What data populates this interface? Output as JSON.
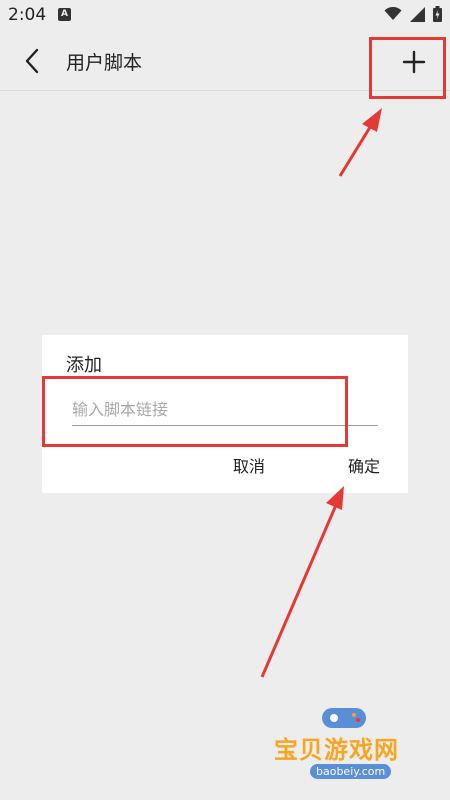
{
  "status_bar": {
    "time": "2:04",
    "notification_letter": "A"
  },
  "app_bar": {
    "title": "用户脚本"
  },
  "dialog": {
    "title": "添加",
    "input_placeholder": "输入脚本链接",
    "input_value": "",
    "cancel_label": "取消",
    "ok_label": "确定"
  },
  "watermark": {
    "brand": "宝贝游戏网",
    "url": "baobeiy.com"
  },
  "colors": {
    "highlight": "#e53935",
    "background": "#ededed",
    "dialog_bg": "#ffffff",
    "watermark": "#f5a623"
  },
  "icons": [
    "back-arrow-icon",
    "plus-icon",
    "wifi-icon",
    "signal-icon",
    "battery-icon",
    "game-controller-icon"
  ]
}
